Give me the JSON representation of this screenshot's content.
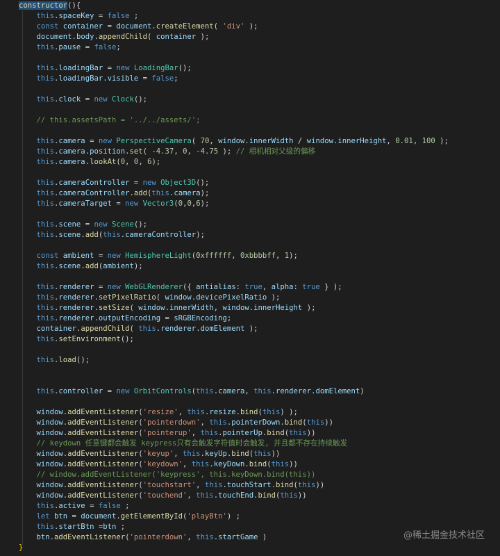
{
  "colors": {
    "background": "#1e1e1e",
    "keyword": "#569cd6",
    "property": "#9cdcfe",
    "function": "#dcdcaa",
    "class": "#4ec9b0",
    "string": "#ce9178",
    "number": "#b5cea8",
    "comment": "#6a9955"
  },
  "watermark": "@稀土掘金技术社区",
  "lines": [
    [
      [
        "hl",
        "constructor"
      ],
      [
        "pun",
        "(){"
      ]
    ],
    [
      [
        "kw",
        "    this"
      ],
      [
        "pun",
        "."
      ],
      [
        "var",
        "spaceKey"
      ],
      [
        "pun",
        " = "
      ],
      [
        "kw",
        "false"
      ],
      [
        "pun",
        " ;"
      ]
    ],
    [
      [
        "kw",
        "    const "
      ],
      [
        "var",
        "container"
      ],
      [
        "pun",
        " = "
      ],
      [
        "var",
        "document"
      ],
      [
        "pun",
        "."
      ],
      [
        "fn",
        "createElement"
      ],
      [
        "pun",
        "( "
      ],
      [
        "str",
        "'div'"
      ],
      [
        "pun",
        " );"
      ]
    ],
    [
      [
        "var",
        "    document"
      ],
      [
        "pun",
        "."
      ],
      [
        "var",
        "body"
      ],
      [
        "pun",
        "."
      ],
      [
        "fn",
        "appendChild"
      ],
      [
        "pun",
        "( "
      ],
      [
        "var",
        "container"
      ],
      [
        "pun",
        " );"
      ]
    ],
    [
      [
        "kw",
        "    this"
      ],
      [
        "pun",
        "."
      ],
      [
        "var",
        "pause"
      ],
      [
        "pun",
        " = "
      ],
      [
        "kw",
        "false"
      ],
      [
        "pun",
        ";"
      ]
    ],
    [],
    [
      [
        "kw",
        "    this"
      ],
      [
        "pun",
        "."
      ],
      [
        "var",
        "loadingBar"
      ],
      [
        "pun",
        " = "
      ],
      [
        "kw",
        "new "
      ],
      [
        "cls",
        "LoadingBar"
      ],
      [
        "pun",
        "();"
      ]
    ],
    [
      [
        "kw",
        "    this"
      ],
      [
        "pun",
        "."
      ],
      [
        "var",
        "loadingBar"
      ],
      [
        "pun",
        "."
      ],
      [
        "var",
        "visible"
      ],
      [
        "pun",
        " = "
      ],
      [
        "kw",
        "false"
      ],
      [
        "pun",
        ";"
      ]
    ],
    [],
    [
      [
        "kw",
        "    this"
      ],
      [
        "pun",
        "."
      ],
      [
        "var",
        "clock"
      ],
      [
        "pun",
        " = "
      ],
      [
        "kw",
        "new "
      ],
      [
        "cls",
        "Clock"
      ],
      [
        "pun",
        "();"
      ]
    ],
    [],
    [
      [
        "cmt",
        "    // this.assetsPath = '../../assets/';"
      ]
    ],
    [],
    [
      [
        "kw",
        "    this"
      ],
      [
        "pun",
        "."
      ],
      [
        "var",
        "camera"
      ],
      [
        "pun",
        " = "
      ],
      [
        "kw",
        "new "
      ],
      [
        "cls",
        "PerspectiveCamera"
      ],
      [
        "pun",
        "( "
      ],
      [
        "num",
        "70"
      ],
      [
        "pun",
        ", "
      ],
      [
        "var",
        "window"
      ],
      [
        "pun",
        "."
      ],
      [
        "var",
        "innerWidth"
      ],
      [
        "pun",
        " / "
      ],
      [
        "var",
        "window"
      ],
      [
        "pun",
        "."
      ],
      [
        "var",
        "innerHeight"
      ],
      [
        "pun",
        ", "
      ],
      [
        "num",
        "0.01"
      ],
      [
        "pun",
        ", "
      ],
      [
        "num",
        "100"
      ],
      [
        "pun",
        " );"
      ]
    ],
    [
      [
        "kw",
        "    this"
      ],
      [
        "pun",
        "."
      ],
      [
        "var",
        "camera"
      ],
      [
        "pun",
        "."
      ],
      [
        "var",
        "position"
      ],
      [
        "pun",
        "."
      ],
      [
        "fn",
        "set"
      ],
      [
        "pun",
        "( "
      ],
      [
        "num",
        "-4.37"
      ],
      [
        "pun",
        ", "
      ],
      [
        "num",
        "0"
      ],
      [
        "pun",
        ", "
      ],
      [
        "num",
        "-4.75"
      ],
      [
        "pun",
        " ); "
      ],
      [
        "cmt",
        "// 相机相对父级的偏移"
      ]
    ],
    [
      [
        "kw",
        "    this"
      ],
      [
        "pun",
        "."
      ],
      [
        "var",
        "camera"
      ],
      [
        "pun",
        "."
      ],
      [
        "fn",
        "lookAt"
      ],
      [
        "pun",
        "("
      ],
      [
        "num",
        "0"
      ],
      [
        "pun",
        ", "
      ],
      [
        "num",
        "0"
      ],
      [
        "pun",
        ", "
      ],
      [
        "num",
        "6"
      ],
      [
        "pun",
        ");"
      ]
    ],
    [],
    [
      [
        "kw",
        "    this"
      ],
      [
        "pun",
        "."
      ],
      [
        "var",
        "cameraController"
      ],
      [
        "pun",
        " = "
      ],
      [
        "kw",
        "new "
      ],
      [
        "cls",
        "Object3D"
      ],
      [
        "pun",
        "();"
      ]
    ],
    [
      [
        "kw",
        "    this"
      ],
      [
        "pun",
        "."
      ],
      [
        "var",
        "cameraController"
      ],
      [
        "pun",
        "."
      ],
      [
        "fn",
        "add"
      ],
      [
        "pun",
        "("
      ],
      [
        "kw",
        "this"
      ],
      [
        "pun",
        "."
      ],
      [
        "var",
        "camera"
      ],
      [
        "pun",
        ");"
      ]
    ],
    [
      [
        "kw",
        "    this"
      ],
      [
        "pun",
        "."
      ],
      [
        "var",
        "cameraTarget"
      ],
      [
        "pun",
        " = "
      ],
      [
        "kw",
        "new "
      ],
      [
        "cls",
        "Vector3"
      ],
      [
        "pun",
        "("
      ],
      [
        "num",
        "0"
      ],
      [
        "pun",
        ","
      ],
      [
        "num",
        "0"
      ],
      [
        "pun",
        ","
      ],
      [
        "num",
        "6"
      ],
      [
        "pun",
        ");"
      ]
    ],
    [],
    [
      [
        "kw",
        "    this"
      ],
      [
        "pun",
        "."
      ],
      [
        "var",
        "scene"
      ],
      [
        "pun",
        " = "
      ],
      [
        "kw",
        "new "
      ],
      [
        "cls",
        "Scene"
      ],
      [
        "pun",
        "();"
      ]
    ],
    [
      [
        "kw",
        "    this"
      ],
      [
        "pun",
        "."
      ],
      [
        "var",
        "scene"
      ],
      [
        "pun",
        "."
      ],
      [
        "fn",
        "add"
      ],
      [
        "pun",
        "("
      ],
      [
        "kw",
        "this"
      ],
      [
        "pun",
        "."
      ],
      [
        "var",
        "cameraController"
      ],
      [
        "pun",
        ");"
      ]
    ],
    [],
    [
      [
        "kw",
        "    const "
      ],
      [
        "var",
        "ambient"
      ],
      [
        "pun",
        " = "
      ],
      [
        "kw",
        "new "
      ],
      [
        "cls",
        "HemisphereLight"
      ],
      [
        "pun",
        "("
      ],
      [
        "num",
        "0xffffff"
      ],
      [
        "pun",
        ", "
      ],
      [
        "num",
        "0xbbbbff"
      ],
      [
        "pun",
        ", "
      ],
      [
        "num",
        "1"
      ],
      [
        "pun",
        ");"
      ]
    ],
    [
      [
        "kw",
        "    this"
      ],
      [
        "pun",
        "."
      ],
      [
        "var",
        "scene"
      ],
      [
        "pun",
        "."
      ],
      [
        "fn",
        "add"
      ],
      [
        "pun",
        "("
      ],
      [
        "var",
        "ambient"
      ],
      [
        "pun",
        ");"
      ]
    ],
    [],
    [
      [
        "kw",
        "    this"
      ],
      [
        "pun",
        "."
      ],
      [
        "var",
        "renderer"
      ],
      [
        "pun",
        " = "
      ],
      [
        "kw",
        "new "
      ],
      [
        "cls",
        "WebGLRenderer"
      ],
      [
        "pun",
        "({ "
      ],
      [
        "var",
        "antialias"
      ],
      [
        "pun",
        ": "
      ],
      [
        "kw",
        "true"
      ],
      [
        "pun",
        ", "
      ],
      [
        "var",
        "alpha"
      ],
      [
        "pun",
        ": "
      ],
      [
        "kw",
        "true"
      ],
      [
        "pun",
        " } );"
      ]
    ],
    [
      [
        "kw",
        "    this"
      ],
      [
        "pun",
        "."
      ],
      [
        "var",
        "renderer"
      ],
      [
        "pun",
        "."
      ],
      [
        "fn",
        "setPixelRatio"
      ],
      [
        "pun",
        "( "
      ],
      [
        "var",
        "window"
      ],
      [
        "pun",
        "."
      ],
      [
        "var",
        "devicePixelRatio"
      ],
      [
        "pun",
        " );"
      ]
    ],
    [
      [
        "kw",
        "    this"
      ],
      [
        "pun",
        "."
      ],
      [
        "var",
        "renderer"
      ],
      [
        "pun",
        "."
      ],
      [
        "fn",
        "setSize"
      ],
      [
        "pun",
        "( "
      ],
      [
        "var",
        "window"
      ],
      [
        "pun",
        "."
      ],
      [
        "var",
        "innerWidth"
      ],
      [
        "pun",
        ", "
      ],
      [
        "var",
        "window"
      ],
      [
        "pun",
        "."
      ],
      [
        "var",
        "innerHeight"
      ],
      [
        "pun",
        " );"
      ]
    ],
    [
      [
        "kw",
        "    this"
      ],
      [
        "pun",
        "."
      ],
      [
        "var",
        "renderer"
      ],
      [
        "pun",
        "."
      ],
      [
        "var",
        "outputEncoding"
      ],
      [
        "pun",
        " = "
      ],
      [
        "var",
        "sRGBEncoding"
      ],
      [
        "pun",
        ";"
      ]
    ],
    [
      [
        "var",
        "    container"
      ],
      [
        "pun",
        "."
      ],
      [
        "fn",
        "appendChild"
      ],
      [
        "pun",
        "( "
      ],
      [
        "kw",
        "this"
      ],
      [
        "pun",
        "."
      ],
      [
        "var",
        "renderer"
      ],
      [
        "pun",
        "."
      ],
      [
        "var",
        "domElement"
      ],
      [
        "pun",
        " );"
      ]
    ],
    [
      [
        "kw",
        "    this"
      ],
      [
        "pun",
        "."
      ],
      [
        "fn",
        "setEnvironment"
      ],
      [
        "pun",
        "();"
      ]
    ],
    [],
    [
      [
        "kw",
        "    this"
      ],
      [
        "pun",
        "."
      ],
      [
        "fn",
        "load"
      ],
      [
        "pun",
        "();"
      ]
    ],
    [],
    [],
    [
      [
        "kw",
        "    this"
      ],
      [
        "pun",
        "."
      ],
      [
        "var",
        "controller"
      ],
      [
        "pun",
        " = "
      ],
      [
        "kw",
        "new "
      ],
      [
        "cls",
        "OrbitControls"
      ],
      [
        "pun",
        "("
      ],
      [
        "kw",
        "this"
      ],
      [
        "pun",
        "."
      ],
      [
        "var",
        "camera"
      ],
      [
        "pun",
        ", "
      ],
      [
        "kw",
        "this"
      ],
      [
        "pun",
        "."
      ],
      [
        "var",
        "renderer"
      ],
      [
        "pun",
        "."
      ],
      [
        "var",
        "domElement"
      ],
      [
        "pun",
        ")"
      ]
    ],
    [],
    [
      [
        "var",
        "    window"
      ],
      [
        "pun",
        "."
      ],
      [
        "fn",
        "addEventListener"
      ],
      [
        "pun",
        "("
      ],
      [
        "str",
        "'resize'"
      ],
      [
        "pun",
        ", "
      ],
      [
        "kw",
        "this"
      ],
      [
        "pun",
        "."
      ],
      [
        "var",
        "resize"
      ],
      [
        "pun",
        "."
      ],
      [
        "fn",
        "bind"
      ],
      [
        "pun",
        "("
      ],
      [
        "kw",
        "this"
      ],
      [
        "pun",
        ") );"
      ]
    ],
    [
      [
        "var",
        "    window"
      ],
      [
        "pun",
        "."
      ],
      [
        "fn",
        "addEventListener"
      ],
      [
        "pun",
        "("
      ],
      [
        "str",
        "'pointerdown'"
      ],
      [
        "pun",
        ", "
      ],
      [
        "kw",
        "this"
      ],
      [
        "pun",
        "."
      ],
      [
        "var",
        "pointerDown"
      ],
      [
        "pun",
        "."
      ],
      [
        "fn",
        "bind"
      ],
      [
        "pun",
        "("
      ],
      [
        "kw",
        "this"
      ],
      [
        "pun",
        "))"
      ]
    ],
    [
      [
        "var",
        "    window"
      ],
      [
        "pun",
        "."
      ],
      [
        "fn",
        "addEventListener"
      ],
      [
        "pun",
        "("
      ],
      [
        "str",
        "'pointerup'"
      ],
      [
        "pun",
        ", "
      ],
      [
        "kw",
        "this"
      ],
      [
        "pun",
        "."
      ],
      [
        "var",
        "pointerUp"
      ],
      [
        "pun",
        "."
      ],
      [
        "fn",
        "bind"
      ],
      [
        "pun",
        "("
      ],
      [
        "kw",
        "this"
      ],
      [
        "pun",
        "))"
      ]
    ],
    [
      [
        "cmt",
        "    // keydown 任意键都会触发 keypress只有会触发字符值时会触发, 并且都不存在持续触发"
      ]
    ],
    [
      [
        "var",
        "    window"
      ],
      [
        "pun",
        "."
      ],
      [
        "fn",
        "addEventListener"
      ],
      [
        "pun",
        "("
      ],
      [
        "str",
        "'keyup'"
      ],
      [
        "pun",
        ", "
      ],
      [
        "kw",
        "this"
      ],
      [
        "pun",
        "."
      ],
      [
        "var",
        "keyUp"
      ],
      [
        "pun",
        "."
      ],
      [
        "fn",
        "bind"
      ],
      [
        "pun",
        "("
      ],
      [
        "kw",
        "this"
      ],
      [
        "pun",
        "))"
      ]
    ],
    [
      [
        "var",
        "    window"
      ],
      [
        "pun",
        "."
      ],
      [
        "fn",
        "addEventListener"
      ],
      [
        "pun",
        "("
      ],
      [
        "str",
        "'keydown'"
      ],
      [
        "pun",
        ", "
      ],
      [
        "kw",
        "this"
      ],
      [
        "pun",
        "."
      ],
      [
        "var",
        "keyDown"
      ],
      [
        "pun",
        "."
      ],
      [
        "fn",
        "bind"
      ],
      [
        "pun",
        "("
      ],
      [
        "kw",
        "this"
      ],
      [
        "pun",
        "))"
      ]
    ],
    [
      [
        "cmt",
        "    // window.addEventListener('keypress', this.keyDown.bind(this))"
      ]
    ],
    [
      [
        "var",
        "    window"
      ],
      [
        "pun",
        "."
      ],
      [
        "fn",
        "addEventListener"
      ],
      [
        "pun",
        "("
      ],
      [
        "str",
        "'touchstart'"
      ],
      [
        "pun",
        ", "
      ],
      [
        "kw",
        "this"
      ],
      [
        "pun",
        "."
      ],
      [
        "var",
        "touchStart"
      ],
      [
        "pun",
        "."
      ],
      [
        "fn",
        "bind"
      ],
      [
        "pun",
        "("
      ],
      [
        "kw",
        "this"
      ],
      [
        "pun",
        "))"
      ]
    ],
    [
      [
        "var",
        "    window"
      ],
      [
        "pun",
        "."
      ],
      [
        "fn",
        "addEventListener"
      ],
      [
        "pun",
        "("
      ],
      [
        "str",
        "'touchend'"
      ],
      [
        "pun",
        ", "
      ],
      [
        "kw",
        "this"
      ],
      [
        "pun",
        "."
      ],
      [
        "var",
        "touchEnd"
      ],
      [
        "pun",
        "."
      ],
      [
        "fn",
        "bind"
      ],
      [
        "pun",
        "("
      ],
      [
        "kw",
        "this"
      ],
      [
        "pun",
        "))"
      ]
    ],
    [
      [
        "kw",
        "    this"
      ],
      [
        "pun",
        "."
      ],
      [
        "var",
        "active"
      ],
      [
        "pun",
        " = "
      ],
      [
        "kw",
        "false"
      ],
      [
        "pun",
        " ;"
      ]
    ],
    [
      [
        "kw",
        "    let "
      ],
      [
        "var",
        "btn"
      ],
      [
        "pun",
        " = "
      ],
      [
        "var",
        "document"
      ],
      [
        "pun",
        "."
      ],
      [
        "fn",
        "getElementById"
      ],
      [
        "pun",
        "("
      ],
      [
        "str",
        "'playBtn'"
      ],
      [
        "pun",
        ") ;"
      ]
    ],
    [
      [
        "kw",
        "    this"
      ],
      [
        "pun",
        "."
      ],
      [
        "var",
        "startBtn"
      ],
      [
        "pun",
        " ="
      ],
      [
        "var",
        "btn"
      ],
      [
        "pun",
        " ;"
      ]
    ],
    [
      [
        "var",
        "    btn"
      ],
      [
        "pun",
        "."
      ],
      [
        "fn",
        "addEventListener"
      ],
      [
        "pun",
        "("
      ],
      [
        "str",
        "'pointerdown'"
      ],
      [
        "pun",
        ", "
      ],
      [
        "kw",
        "this"
      ],
      [
        "pun",
        "."
      ],
      [
        "var",
        "startGame"
      ],
      [
        "pun",
        " )"
      ]
    ],
    [
      [
        "brk",
        "}"
      ]
    ]
  ]
}
